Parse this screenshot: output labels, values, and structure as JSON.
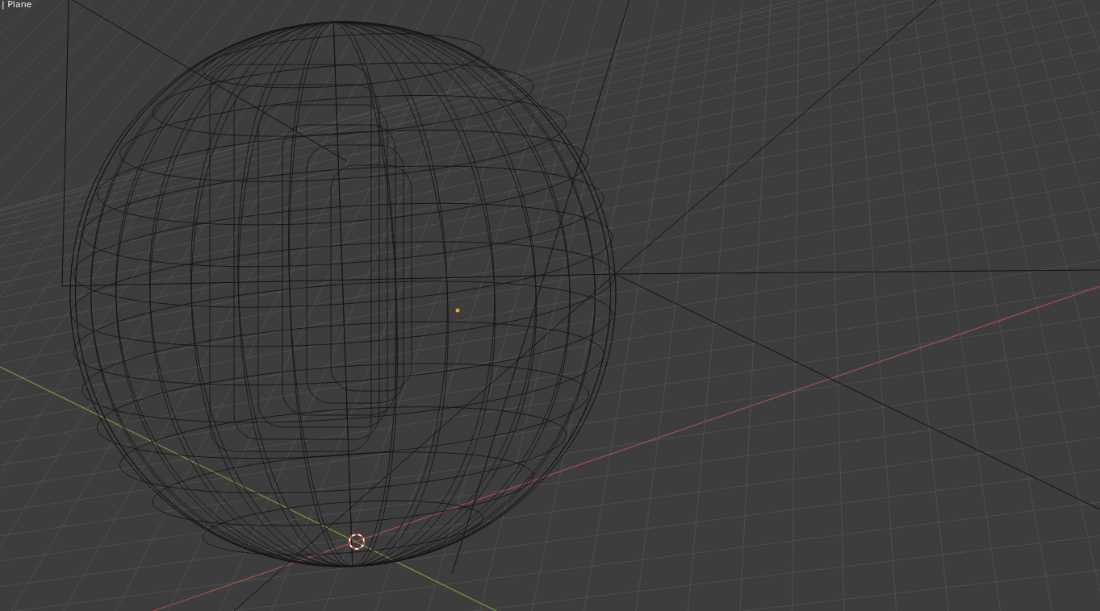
{
  "viewport": {
    "object_label": "| Plane"
  }
}
